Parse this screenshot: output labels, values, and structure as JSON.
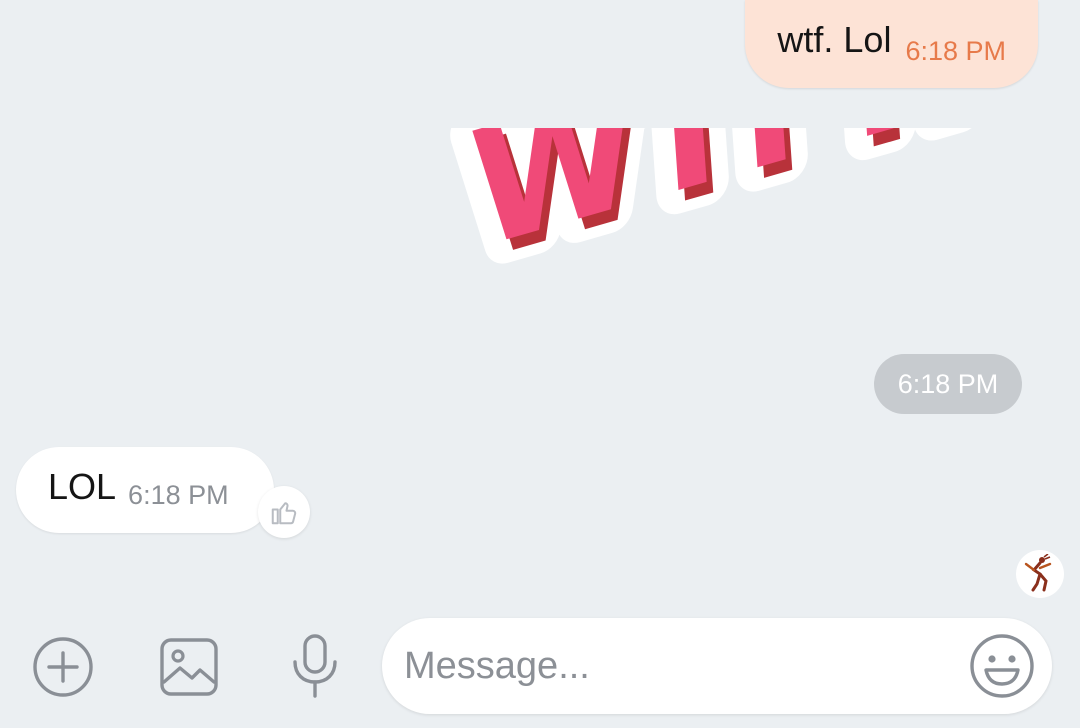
{
  "messages": {
    "outgoing_text": {
      "text": "wtf. Lol",
      "time": "6:18 PM"
    },
    "outgoing_sticker": {
      "sticker_text": "WTF!!?",
      "time": "6:18 PM"
    },
    "incoming_text": {
      "text": "LOL",
      "time": "6:18 PM"
    }
  },
  "composer": {
    "placeholder": "Message..."
  },
  "icons": {
    "add": "plus-circle-icon",
    "gallery": "image-icon",
    "mic": "microphone-icon",
    "emoji": "smiley-icon",
    "like": "thumbs-up-icon"
  },
  "colors": {
    "background": "#ebeff2",
    "outgoing_bubble": "#fde3d6",
    "outgoing_time": "#e77a4a",
    "incoming_bubble": "#ffffff",
    "sticker_fill": "#f04a78",
    "sticker_shadow": "#b8323a",
    "icon_gray": "#8a8f96"
  }
}
